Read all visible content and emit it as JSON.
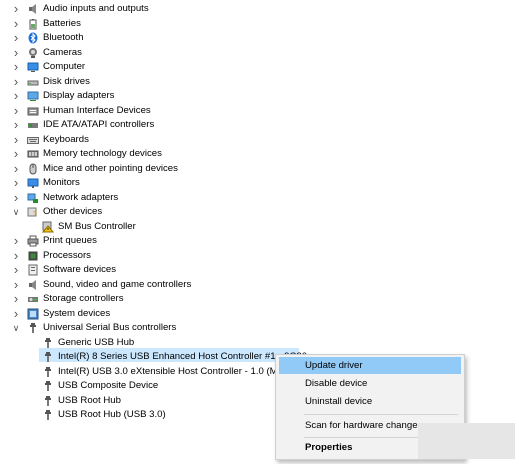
{
  "tree": {
    "items": [
      {
        "label": "Audio inputs and outputs",
        "icon": "speaker-icon",
        "expand": "collapsed"
      },
      {
        "label": "Batteries",
        "icon": "battery-icon",
        "expand": "collapsed"
      },
      {
        "label": "Bluetooth",
        "icon": "bluetooth-icon",
        "expand": "collapsed"
      },
      {
        "label": "Cameras",
        "icon": "camera-icon",
        "expand": "collapsed"
      },
      {
        "label": "Computer",
        "icon": "computer-icon",
        "expand": "collapsed"
      },
      {
        "label": "Disk drives",
        "icon": "disk-drive-icon",
        "expand": "collapsed"
      },
      {
        "label": "Display adapters",
        "icon": "display-adapter-icon",
        "expand": "collapsed"
      },
      {
        "label": "Human Interface Devices",
        "icon": "hid-icon",
        "expand": "collapsed"
      },
      {
        "label": "IDE ATA/ATAPI controllers",
        "icon": "ide-controller-icon",
        "expand": "collapsed"
      },
      {
        "label": "Keyboards",
        "icon": "keyboard-icon",
        "expand": "collapsed"
      },
      {
        "label": "Memory technology devices",
        "icon": "memory-icon",
        "expand": "collapsed"
      },
      {
        "label": "Mice and other pointing devices",
        "icon": "mouse-icon",
        "expand": "collapsed"
      },
      {
        "label": "Monitors",
        "icon": "monitor-icon",
        "expand": "collapsed"
      },
      {
        "label": "Network adapters",
        "icon": "network-adapter-icon",
        "expand": "collapsed"
      },
      {
        "label": "Other devices",
        "icon": "other-devices-icon",
        "expand": "expanded"
      },
      {
        "label": "SM Bus Controller",
        "icon": "warning-device-icon",
        "expand": "none",
        "child": true
      },
      {
        "label": "Print queues",
        "icon": "printer-icon",
        "expand": "collapsed"
      },
      {
        "label": "Processors",
        "icon": "processor-icon",
        "expand": "collapsed"
      },
      {
        "label": "Software devices",
        "icon": "software-device-icon",
        "expand": "collapsed"
      },
      {
        "label": "Sound, video and game controllers",
        "icon": "sound-icon",
        "expand": "collapsed"
      },
      {
        "label": "Storage controllers",
        "icon": "storage-controller-icon",
        "expand": "collapsed"
      },
      {
        "label": "System devices",
        "icon": "system-device-icon",
        "expand": "collapsed"
      },
      {
        "label": "Universal Serial Bus controllers",
        "icon": "usb-icon",
        "expand": "expanded"
      },
      {
        "label": "Generic USB Hub",
        "icon": "usb-icon",
        "expand": "none",
        "child": true
      },
      {
        "label": "Intel(R) 8 Series USB Enhanced Host Controller #1 - 9C26",
        "icon": "usb-icon",
        "expand": "none",
        "child": true,
        "selected": true
      },
      {
        "label": "Intel(R) USB 3.0 eXtensible Host Controller - 1.0 (Microsoft)",
        "icon": "usb-icon",
        "expand": "none",
        "child": true
      },
      {
        "label": "USB Composite Device",
        "icon": "usb-icon",
        "expand": "none",
        "child": true
      },
      {
        "label": "USB Root Hub",
        "icon": "usb-icon",
        "expand": "none",
        "child": true
      },
      {
        "label": "USB Root Hub (USB 3.0)",
        "icon": "usb-icon",
        "expand": "none",
        "child": true
      }
    ]
  },
  "context_menu": {
    "update_driver": "Update driver",
    "disable_device": "Disable device",
    "uninstall_device": "Uninstall device",
    "scan_hardware": "Scan for hardware changes",
    "properties": "Properties"
  },
  "colors": {
    "selection": "#cce8ff",
    "menu_highlight": "#91c9f7",
    "menu_bg": "#f2f2f2"
  }
}
